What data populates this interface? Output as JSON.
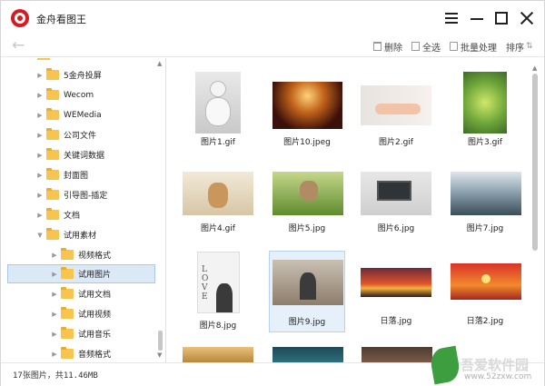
{
  "window": {
    "title": "金舟看图王"
  },
  "toolbar": {
    "delete_label": "删除",
    "select_all_label": "全选",
    "batch_label": "批量处理",
    "sort_label": "排序"
  },
  "sidebar": {
    "items": [
      {
        "label": "5金舟投屏"
      },
      {
        "label": "Wecom"
      },
      {
        "label": "WEMedia"
      },
      {
        "label": "公司文件"
      },
      {
        "label": "关键词数据"
      },
      {
        "label": "封面图"
      },
      {
        "label": "引导图-插定"
      },
      {
        "label": "文档"
      },
      {
        "label": "试用素材"
      },
      {
        "label": "视频格式"
      },
      {
        "label": "试用图片"
      },
      {
        "label": "试用文档"
      },
      {
        "label": "试用视频"
      },
      {
        "label": "试用音乐"
      },
      {
        "label": "音频格式"
      }
    ]
  },
  "thumbnails": [
    {
      "name": "图片1.gif"
    },
    {
      "name": "图片10.jpeg"
    },
    {
      "name": "图片2.gif"
    },
    {
      "name": "图片3.gif"
    },
    {
      "name": "图片4.gif"
    },
    {
      "name": "图片5.jpg"
    },
    {
      "name": "图片6.jpg"
    },
    {
      "name": "图片7.jpg"
    },
    {
      "name": "图片8.jpg"
    },
    {
      "name": "图片9.jpg"
    },
    {
      "name": "日落.jpg"
    },
    {
      "name": "日落2.jpg"
    }
  ],
  "status": {
    "text": "17张图片，共11.46MB"
  },
  "watermark": {
    "title": "吾爱软件园",
    "url": "www.52zxw.com"
  },
  "colors": {
    "accent": "#d71920",
    "selected_bg": "#dbe9f7",
    "folder": "#f6c44f"
  }
}
